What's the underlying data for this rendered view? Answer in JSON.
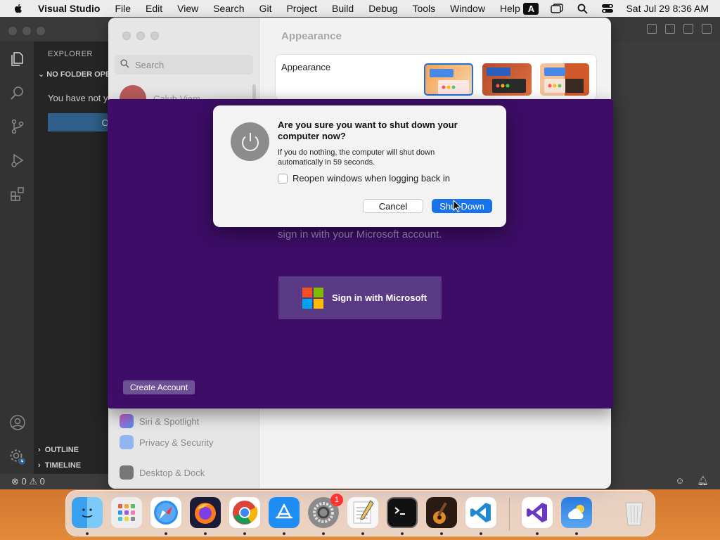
{
  "menubar": {
    "app_name": "Visual Studio",
    "items": [
      "File",
      "Edit",
      "View",
      "Search",
      "Git",
      "Project",
      "Build",
      "Debug",
      "Tools",
      "Window",
      "Help"
    ],
    "input_source": "A",
    "datetime": "Sat Jul 29  8:36 AM"
  },
  "vscode": {
    "explorer_label": "EXPLORER",
    "no_folder_label": "NO FOLDER OPE",
    "you_have_not": "You have not y",
    "open_button": "Op",
    "outline_label": "OUTLINE",
    "timeline_label": "TIMELINE",
    "problems_errors": "0",
    "problems_warnings": "0"
  },
  "settings": {
    "search_placeholder": "Search",
    "user_name": "Calub Viem",
    "main_title": "Appearance",
    "appearance_label": "Appearance",
    "sidebar_items": [
      "Siri & Spotlight",
      "Privacy & Security",
      "Desktop & Dock"
    ]
  },
  "microsoft": {
    "signin_text": "sign in with your Microsoft account.",
    "signin_button": "Sign in with Microsoft",
    "create_account": "Create Account"
  },
  "dialog": {
    "title": "Are you sure you want to shut down your computer now?",
    "body": "If you do nothing, the computer will shut down automatically in 59 seconds.",
    "checkbox_label": "Reopen windows when logging back in",
    "checkbox_checked": false,
    "cancel_button": "Cancel",
    "shutdown_button": "Shut Down"
  },
  "dock": {
    "apps": [
      "Finder",
      "Launchpad",
      "Safari",
      "Firefox",
      "Chrome",
      "App Store",
      "System Settings",
      "TextEdit",
      "Terminal",
      "GarageBand",
      "Visual Studio Code",
      "Visual Studio",
      "Weather",
      "Trash"
    ],
    "settings_badge": "1"
  },
  "colors": {
    "accent": "#1a72e8",
    "purple_bg": "#3d0d67",
    "ms_red": "#f25022",
    "ms_green": "#7fba00",
    "ms_blue": "#00a4ef",
    "ms_yellow": "#ffb900"
  }
}
